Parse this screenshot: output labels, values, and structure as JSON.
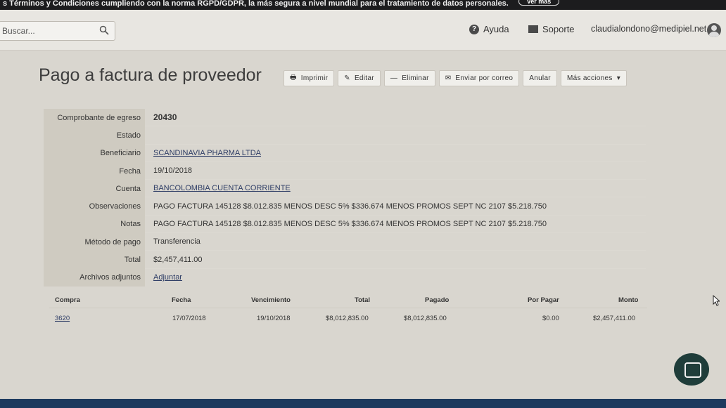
{
  "banner": {
    "text": "s Términos y Condiciones cumpliendo con la norma RGPD/GDPR, la más segura a nivel mundial para el tratamiento de datos personales.",
    "button_label": "Ver más"
  },
  "header": {
    "search": {
      "placeholder": "Buscar..."
    },
    "help_label": "Ayuda",
    "support_label": "Soporte",
    "user_email": "claudialondono@medipiel.net"
  },
  "page": {
    "title": "Pago a factura de proveedor",
    "actions": {
      "print": "Imprimir",
      "edit": "Editar",
      "delete": "Eliminar",
      "email": "Enviar por correo",
      "void": "Anular",
      "more": "Más acciones"
    }
  },
  "details": {
    "fields": [
      {
        "label": "Comprobante de egreso",
        "value": "20430"
      },
      {
        "label": "Estado",
        "value": ""
      },
      {
        "label": "Beneficiario",
        "value": "SCANDINAVIA PHARMA LTDA"
      },
      {
        "label": "Fecha",
        "value": "19/10/2018"
      },
      {
        "label": "Cuenta",
        "value": "BANCOLOMBIA CUENTA CORRIENTE"
      },
      {
        "label": "Observaciones",
        "value": "PAGO FACTURA 145128 $8.012.835 MENOS DESC 5% $336.674 MENOS PROMOS SEPT NC 2107 $5.218.750"
      },
      {
        "label": "Notas",
        "value": "PAGO FACTURA 145128 $8.012.835 MENOS DESC 5% $336.674 MENOS PROMOS SEPT NC 2107 $5.218.750"
      },
      {
        "label": "Método de pago",
        "value": "Transferencia"
      },
      {
        "label": "Total",
        "value": "$2,457,411.00"
      },
      {
        "label": "Archivos adjuntos",
        "value": "Adjuntar"
      }
    ]
  },
  "table": {
    "headers": [
      "Compra",
      "Fecha",
      "Vencimiento",
      "Total",
      "Pagado",
      "Por Pagar",
      "Monto"
    ],
    "rows": [
      [
        "3620",
        "17/07/2018",
        "19/10/2018",
        "$8,012,835.00",
        "$8,012,835.00",
        "$0.00",
        "$2,457,411.00"
      ]
    ]
  }
}
